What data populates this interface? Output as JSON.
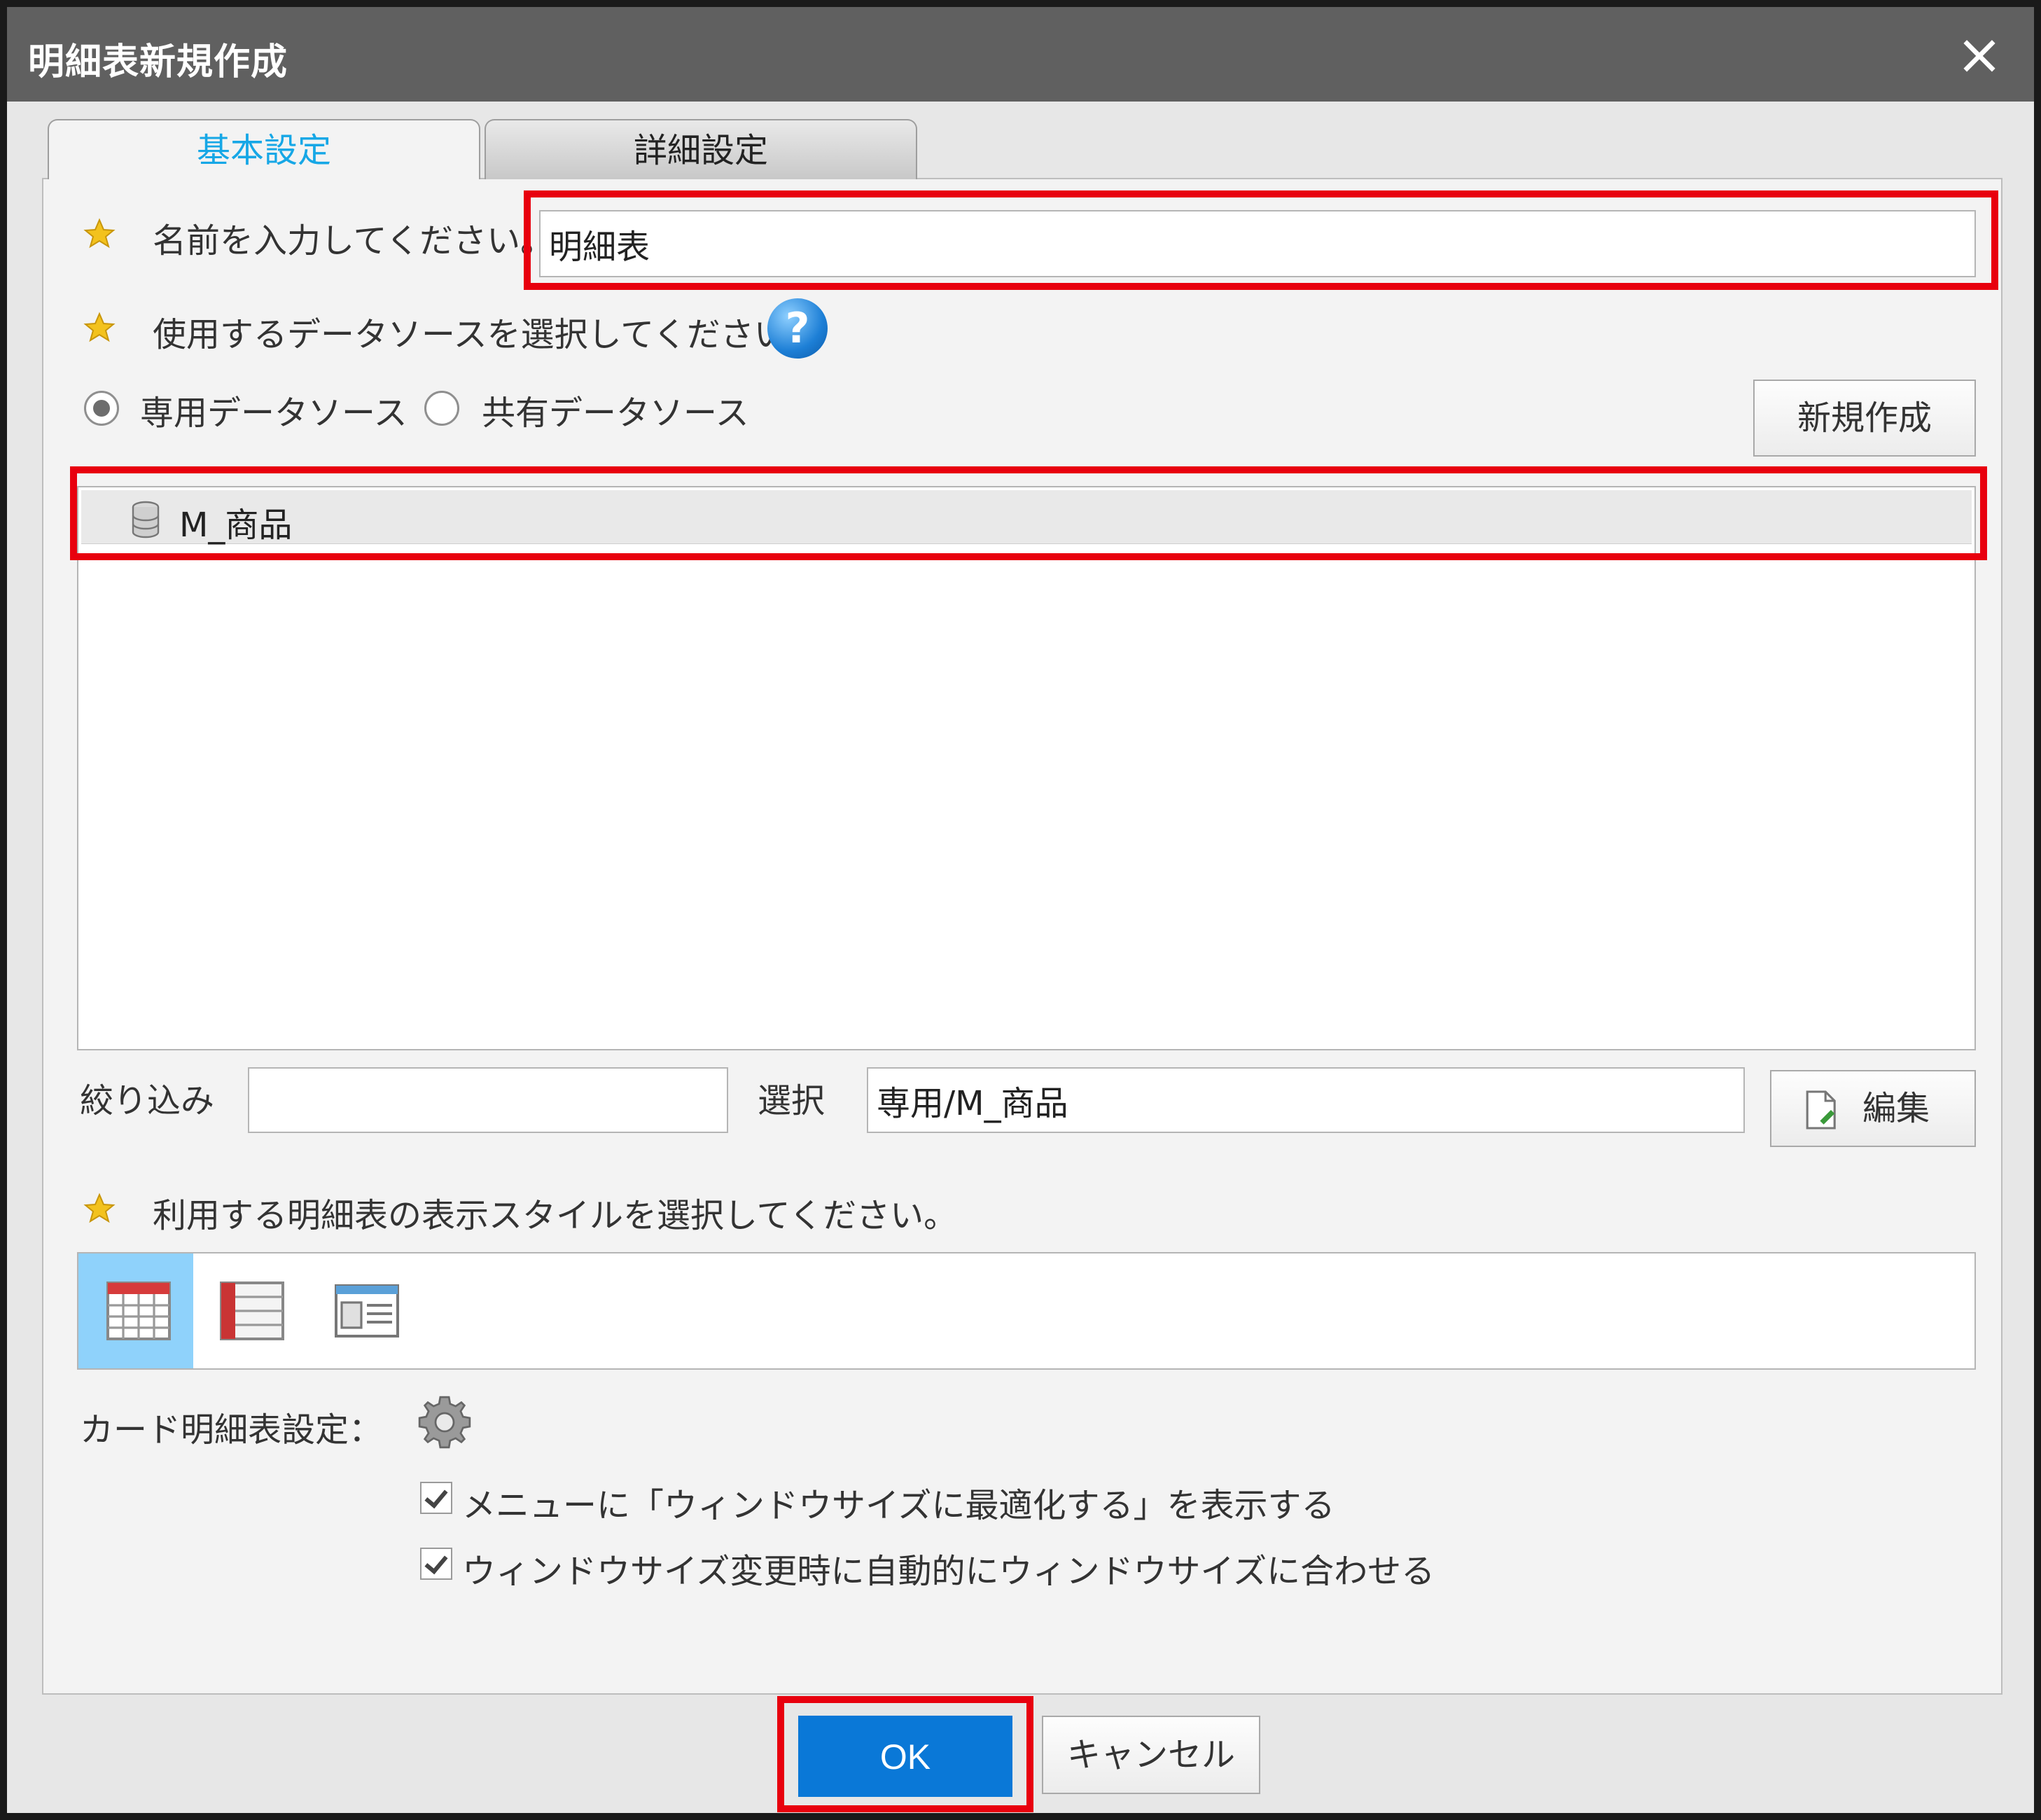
{
  "dialog": {
    "title": "明細表新規作成",
    "close_icon": "×"
  },
  "tabs": [
    {
      "label": "基本設定",
      "active": true
    },
    {
      "label": "詳細設定",
      "active": false
    }
  ],
  "name_section": {
    "label": "名前を入力してください。",
    "value": "明細表"
  },
  "datasource_section": {
    "label": "使用するデータソースを選択してください。",
    "help_icon": "?",
    "radio_dedicated": "専用データソース",
    "radio_shared": "共有データソース",
    "selected_radio": "dedicated",
    "new_button": "新規作成",
    "items": [
      "M_商品"
    ]
  },
  "filter_row": {
    "filter_label": "絞り込み",
    "filter_value": "",
    "select_label": "選択",
    "select_value": "専用/M_商品",
    "edit_button": "編集"
  },
  "style_section": {
    "label": "利用する明細表の表示スタイルを選択してください。",
    "selected_index": 0
  },
  "card_settings": {
    "label": "カード明細表設定：",
    "options": [
      {
        "label": "メニューに「ウィンドウサイズに最適化する」を表示する",
        "checked": true
      },
      {
        "label": "ウィンドウサイズ変更時に自動的にウィンドウサイズに合わせる",
        "checked": true
      }
    ]
  },
  "footer": {
    "ok_button": "OK",
    "cancel_button": "キャンセル"
  },
  "colors": {
    "accent": "#0a78d7",
    "active_tab_text": "#16a7e6",
    "highlight": "#e8000e",
    "selected_style": "#8fd2fb"
  }
}
